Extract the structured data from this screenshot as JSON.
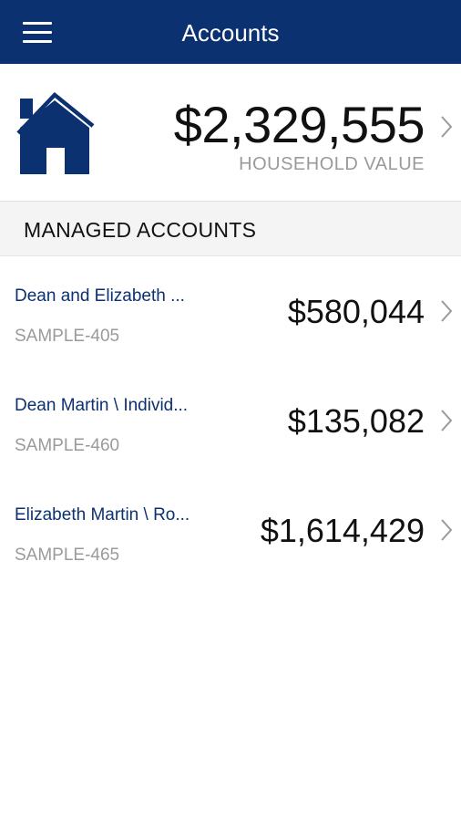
{
  "header": {
    "title": "Accounts"
  },
  "household": {
    "value": "$2,329,555",
    "label": "HOUSEHOLD VALUE"
  },
  "section": {
    "title": "MANAGED ACCOUNTS"
  },
  "accounts": [
    {
      "name": "Dean and Elizabeth ...",
      "id": "SAMPLE-405",
      "value": "$580,044"
    },
    {
      "name": "Dean Martin \\ Individ...",
      "id": "SAMPLE-460",
      "value": "$135,082"
    },
    {
      "name": "Elizabeth Martin \\ Ro...",
      "id": "SAMPLE-465",
      "value": "$1,614,429"
    }
  ],
  "colors": {
    "brand": "#0b3170",
    "muted": "#9a9a9a",
    "section_bg": "#f4f4f4"
  },
  "icons": {
    "menu": "hamburger-menu-icon",
    "home": "house-icon",
    "disclosure": "chevron-right-icon"
  }
}
